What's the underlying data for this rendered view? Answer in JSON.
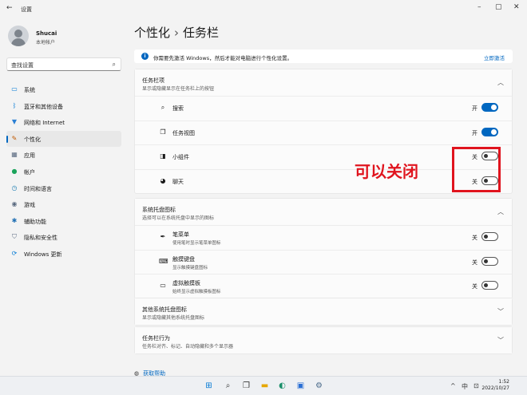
{
  "window": {
    "title": "设置",
    "back_glyph": "←",
    "minimize_glyph": "–",
    "maximize_glyph": "▢",
    "close_glyph": "✕"
  },
  "user": {
    "name": "Shucai",
    "account_type": "本地帐户"
  },
  "search": {
    "placeholder": "查找设置",
    "icon": "search-icon"
  },
  "sidebar": {
    "items": [
      {
        "label": "系统",
        "icon": "monitor-icon",
        "glyph": "▭",
        "color": "#0078d4"
      },
      {
        "label": "蓝牙和其他设备",
        "icon": "bluetooth-icon",
        "glyph": "ᛒ",
        "color": "#0078d4"
      },
      {
        "label": "网络和 Internet",
        "icon": "wifi-icon",
        "glyph": "▼",
        "color": "#2a7fd4"
      },
      {
        "label": "个性化",
        "icon": "brush-icon",
        "glyph": "✎",
        "color": "#c05a00",
        "active": true
      },
      {
        "label": "应用",
        "icon": "apps-icon",
        "glyph": "▦",
        "color": "#5a6a80"
      },
      {
        "label": "帐户",
        "icon": "person-icon",
        "glyph": "●",
        "color": "#1aa35a"
      },
      {
        "label": "时间和语言",
        "icon": "globe-clock-icon",
        "glyph": "◷",
        "color": "#1f7fb3"
      },
      {
        "label": "游戏",
        "icon": "gamepad-icon",
        "glyph": "◉",
        "color": "#5a6a80"
      },
      {
        "label": "辅助功能",
        "icon": "accessibility-icon",
        "glyph": "✱",
        "color": "#1f6fb3"
      },
      {
        "label": "隐私和安全性",
        "icon": "shield-icon",
        "glyph": "⛉",
        "color": "#5a6a80"
      },
      {
        "label": "Windows 更新",
        "icon": "update-icon",
        "glyph": "⟳",
        "color": "#0078d4"
      }
    ]
  },
  "breadcrumb": {
    "parent": "个性化",
    "separator": "›",
    "current": "任务栏"
  },
  "banner": {
    "icon": "info-icon",
    "text": "你需要先激活 Windows，然后才能对电脑进行个性化设置。",
    "link": "立即激活"
  },
  "sections": [
    {
      "title": "任务栏项",
      "subtitle": "显示或隐藏显示在任务栏上的按钮",
      "expanded": true,
      "rows": [
        {
          "icon": "search-icon",
          "glyph": "⌕",
          "label": "搜索",
          "state": "开",
          "on": true
        },
        {
          "icon": "task-view-icon",
          "glyph": "❐",
          "label": "任务视图",
          "state": "开",
          "on": true
        },
        {
          "icon": "widgets-icon",
          "glyph": "◨",
          "label": "小组件",
          "state": "关",
          "on": false
        },
        {
          "icon": "chat-icon",
          "glyph": "◕",
          "label": "聊天",
          "state": "关",
          "on": false
        }
      ]
    },
    {
      "title": "系统托盘图标",
      "subtitle": "选择可以在系统托盘中显示的图标",
      "expanded": true,
      "rows": [
        {
          "icon": "pen-icon",
          "glyph": "✒",
          "label": "笔菜单",
          "sub": "使用笔时显示笔菜单图标",
          "state": "关",
          "on": false
        },
        {
          "icon": "keyboard-icon",
          "glyph": "⌨",
          "label": "触摸键盘",
          "sub": "显示触摸键盘图标",
          "state": "关",
          "on": false
        },
        {
          "icon": "touchpad-icon",
          "glyph": "▭",
          "label": "虚拟触摸板",
          "sub": "始终显示虚拟触摸板图标",
          "state": "关",
          "on": false
        }
      ]
    },
    {
      "title": "其他系统托盘图标",
      "subtitle": "显示或隐藏其他系统托盘图标",
      "expanded": false
    },
    {
      "title": "任务栏行为",
      "subtitle": "任务栏对齐、标记、自动隐藏和多个显示器",
      "expanded": false
    }
  ],
  "annotation": {
    "text": "可以关闭",
    "color": "#e0141e"
  },
  "help": {
    "icon": "help-icon",
    "label": "获取帮助"
  },
  "taskbar": {
    "apps": [
      {
        "icon": "start-icon",
        "glyph": "⊞",
        "color": "#0078d4"
      },
      {
        "icon": "search-icon",
        "glyph": "⌕",
        "color": "#333333"
      },
      {
        "icon": "task-view-icon",
        "glyph": "❐",
        "color": "#333333"
      },
      {
        "icon": "explorer-icon",
        "glyph": "▬",
        "color": "#e6a700"
      },
      {
        "icon": "edge-icon",
        "glyph": "◐",
        "color": "#1a8f6a"
      },
      {
        "icon": "store-icon",
        "glyph": "▣",
        "color": "#2a6fd4"
      },
      {
        "icon": "settings-icon",
        "glyph": "⚙",
        "color": "#4a6a8a"
      }
    ],
    "tray": {
      "chevron": "^",
      "input_method": "中",
      "ime_mode": "⊡"
    },
    "clock": {
      "time": "1:52",
      "date": "2022/10/27"
    }
  }
}
